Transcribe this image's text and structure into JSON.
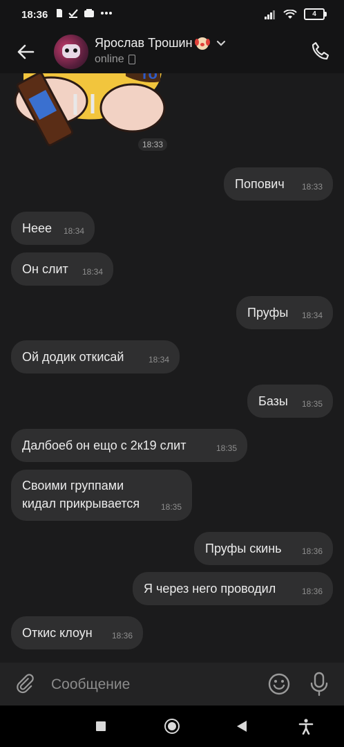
{
  "status_bar": {
    "time": "18:36",
    "battery": "4"
  },
  "header": {
    "contact_name": "Ярослав Трошин",
    "status": "online"
  },
  "sticker": {
    "time": "18:33"
  },
  "messages": [
    {
      "side": "out",
      "text": "Попович",
      "time": "18:33"
    },
    {
      "side": "in",
      "text": "Неее",
      "time": "18:34"
    },
    {
      "side": "in",
      "text": "Он слит",
      "time": "18:34"
    },
    {
      "side": "out",
      "text": "Пруфы",
      "time": "18:34"
    },
    {
      "side": "in",
      "text": "Ой додик откисай",
      "time": "18:34"
    },
    {
      "side": "out",
      "text": "Базы",
      "time": "18:35"
    },
    {
      "side": "in",
      "text": "Далбоеб он ещо с 2к19 слит",
      "time": "18:35"
    },
    {
      "side": "in",
      "text": "Своими группами кидал прикрывается",
      "time": "18:35"
    },
    {
      "side": "out",
      "text": "Пруфы скинь",
      "time": "18:36"
    },
    {
      "side": "out",
      "text": "Я через него проводил",
      "time": "18:36"
    },
    {
      "side": "in",
      "text": "Откис клоун",
      "time": "18:36"
    }
  ],
  "composer": {
    "placeholder": "Сообщение"
  },
  "icons": {
    "back": "arrow-left-icon",
    "call": "phone-icon",
    "attach": "paperclip-icon",
    "emoji": "smiley-icon",
    "mic": "microphone-icon"
  },
  "colors": {
    "background": "#1b1b1c",
    "bubble": "#2f2f30",
    "header": "#141415"
  }
}
